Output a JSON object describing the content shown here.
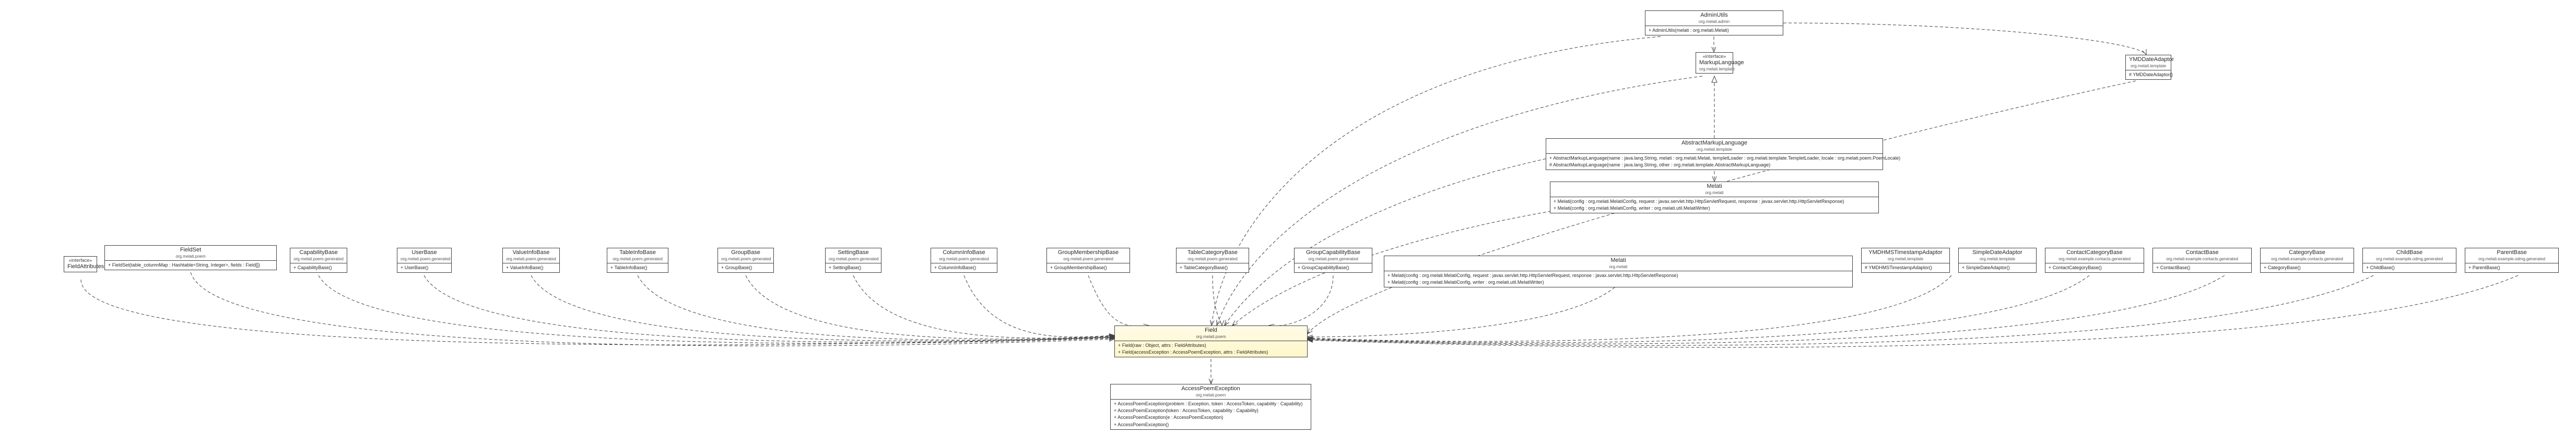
{
  "nodes": {
    "adminutils": {
      "name": "AdminUtils",
      "pkg": "org.melati.admin",
      "ops": [
        "+ AdminUtils(melati : org.melati.Melati)"
      ]
    },
    "ml_iface": {
      "stereo": "«interface»",
      "name": "MarkupLanguage",
      "pkg": "org.melati.template"
    },
    "yoda": {
      "name": "YMDDateAdaptor",
      "pkg": "org.melati.template",
      "ops": [
        "# YMDDateAdaptor()"
      ]
    },
    "aml": {
      "name": "AbstractMarkupLanguage",
      "pkg": "org.melati.template",
      "ops": [
        "+ AbstractMarkupLanguage(name : java.lang.String, melati : org.melati.Melati, templetLoader : org.melati.template.TempletLoader, locale : org.melati.poem.PoemLocale)",
        "# AbstractMarkupLanguage(name : java.lang.String, other : org.melati.template.AbstractMarkupLanguage)"
      ]
    },
    "melati_top": {
      "name": "Melati",
      "pkg": "org.melati",
      "ops": [
        "+ Melati(config : org.melati.MelatiConfig, request : javax.servlet.http.HttpServletRequest, response : javax.servlet.http.HttpServletResponse)",
        "+ Melati(config : org.melati.MelatiConfig, writer : org.melati.util.MelatiWriter)"
      ]
    },
    "fa_iface": {
      "stereo": "«interface»",
      "name": "FieldAttributes"
    },
    "fieldset": {
      "name": "FieldSet",
      "pkg": "org.melati.poem",
      "ops": [
        "+ FieldSet(table_columnMap : Hashtable<String, Integer>, fields : Field[])"
      ]
    },
    "capbase": {
      "name": "CapabilityBase",
      "pkg": "org.melati.poem.generated",
      "ops": [
        "+ CapabilityBase()"
      ]
    },
    "userbase": {
      "name": "UserBase",
      "pkg": "org.melati.poem.generated",
      "ops": [
        "+ UserBase()"
      ]
    },
    "valuebase": {
      "name": "ValueInfoBase",
      "pkg": "org.melati.poem.generated",
      "ops": [
        "+ ValueInfoBase()"
      ]
    },
    "tibase": {
      "name": "TableInfoBase",
      "pkg": "org.melati.poem.generated",
      "ops": [
        "+ TableInfoBase()"
      ]
    },
    "groupbase": {
      "name": "GroupBase",
      "pkg": "org.melati.poem.generated",
      "ops": [
        "+ GroupBase()"
      ]
    },
    "settingbase": {
      "name": "SettingBase",
      "pkg": "org.melati.poem.generated",
      "ops": [
        "+ SettingBase()"
      ]
    },
    "cibase": {
      "name": "ColumnInfoBase",
      "pkg": "org.melati.poem.generated",
      "ops": [
        "+ ColumnInfoBase()"
      ]
    },
    "gmbase": {
      "name": "GroupMembershipBase",
      "pkg": "org.melati.poem.generated",
      "ops": [
        "+ GroupMembershipBase()"
      ]
    },
    "tcbase": {
      "name": "TableCategoryBase",
      "pkg": "org.melati.poem.generated",
      "ops": [
        "+ TableCategoryBase()"
      ]
    },
    "gcbase": {
      "name": "GroupCapabilityBase",
      "pkg": "org.melati.poem.generated",
      "ops": [
        "+ GroupCapabilityBase()"
      ]
    },
    "melati_row": {
      "name": "Melati",
      "pkg": "org.melati",
      "ops": [
        "+ Melati(config : org.melati.MelatiConfig, request : javax.servlet.http.HttpServletRequest, response : javax.servlet.http.HttpServletResponse)",
        "+ Melati(config : org.melati.MelatiConfig, writer : org.melati.util.MelatiWriter)"
      ]
    },
    "ymdts": {
      "name": "YMDHMSTimestampAdaptor",
      "pkg": "org.melati.template",
      "ops": [
        "# YMDHMSTimestampAdaptor()"
      ]
    },
    "sda": {
      "name": "SimpleDateAdaptor",
      "pkg": "org.melati.template",
      "ops": [
        "+ SimpleDateAdaptor()"
      ]
    },
    "ccbase": {
      "name": "ContactCategoryBase",
      "pkg": "org.melati.example.contacts.generated",
      "ops": [
        "+ ContactCategoryBase()"
      ]
    },
    "contactbase": {
      "name": "ContactBase",
      "pkg": "org.melati.example.contacts.generated",
      "ops": [
        "+ ContactBase()"
      ]
    },
    "catbase": {
      "name": "CategoryBase",
      "pkg": "org.melati.example.contacts.generated",
      "ops": [
        "+ CategoryBase()"
      ]
    },
    "childbase": {
      "name": "ChildBase",
      "pkg": "org.melati.example.odmg.generated",
      "ops": [
        "+ ChildBase()"
      ]
    },
    "parentbase": {
      "name": "ParentBase",
      "pkg": "org.melati.example.odmg.generated",
      "ops": [
        "+ ParentBase()"
      ]
    },
    "field": {
      "name": "Field",
      "pkg": "org.melati.poem",
      "ops": [
        "+ Field(raw : Object, attrs : FieldAttributes)",
        "+ Field(accessException : AccessPoemException, attrs : FieldAttributes)"
      ]
    },
    "ape": {
      "name": "AccessPoemException",
      "pkg": "org.melati.poem",
      "ops": [
        "+ AccessPoemException(problem : Exception, token : AccessToken, capability : Capability)",
        "+ AccessPoemException(token : AccessToken, capability : Capability)",
        "+ AccessPoemException(e : AccessPoemException)",
        "+ AccessPoemException()"
      ]
    }
  }
}
